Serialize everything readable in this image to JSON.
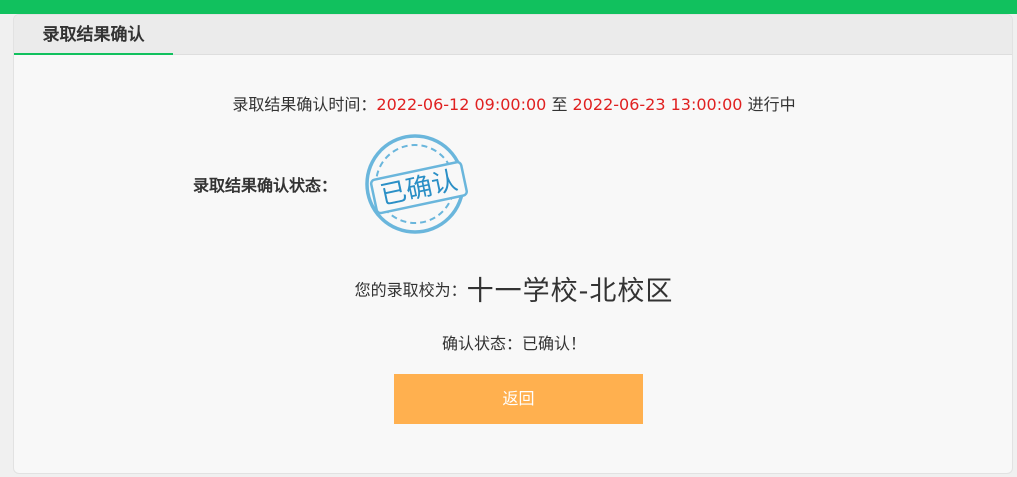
{
  "header": {
    "tab_title": "录取结果确认"
  },
  "time_row": {
    "label": "录取结果确认时间：",
    "start": "2022-06-12 09:00:00",
    "separator": " 至 ",
    "end": "2022-06-23 13:00:00",
    "status": " 进行中"
  },
  "status": {
    "label": "录取结果确认状态：",
    "stamp_text": "已确认"
  },
  "school": {
    "label": "您的录取校为：",
    "name": "十一学校-北校区"
  },
  "confirm": {
    "text": "确认状态：已确认！"
  },
  "back_button": {
    "label": "返回"
  },
  "colors": {
    "accent_green": "#11c15e",
    "highlight_red": "#e02020",
    "button_orange": "#ffb04f",
    "stamp_blue": "#2a8fc6"
  }
}
